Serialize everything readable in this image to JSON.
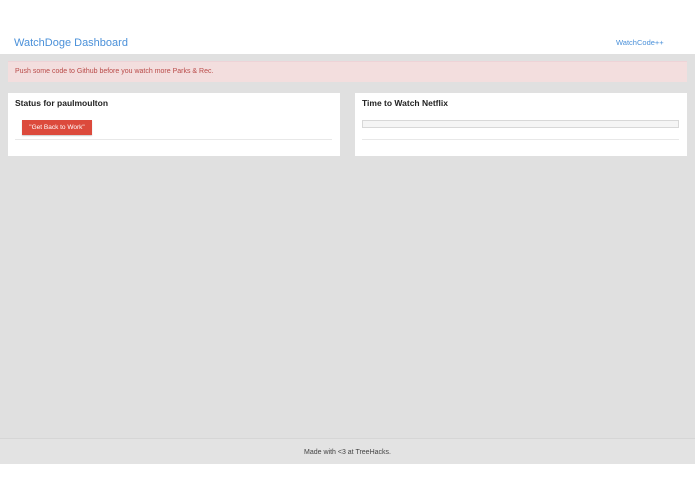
{
  "navbar": {
    "brand": "WatchDoge Dashboard",
    "link": "WatchCode++"
  },
  "alert": {
    "message": "Push some code to Github before you watch more Parks & Rec."
  },
  "status_card": {
    "title": "Status for paulmoulton",
    "button_label": "\"Get Back to Work\""
  },
  "netflix_card": {
    "title": "Time to Watch Netflix",
    "progress": 0
  },
  "footer": {
    "text": "Made with <3 at TreeHacks."
  },
  "colors": {
    "link": "#4a90d9",
    "alert_bg": "#f3dede",
    "alert_text": "#b94a48",
    "button_bg": "#dc4a3c",
    "page_bg": "#e0e0e0"
  }
}
